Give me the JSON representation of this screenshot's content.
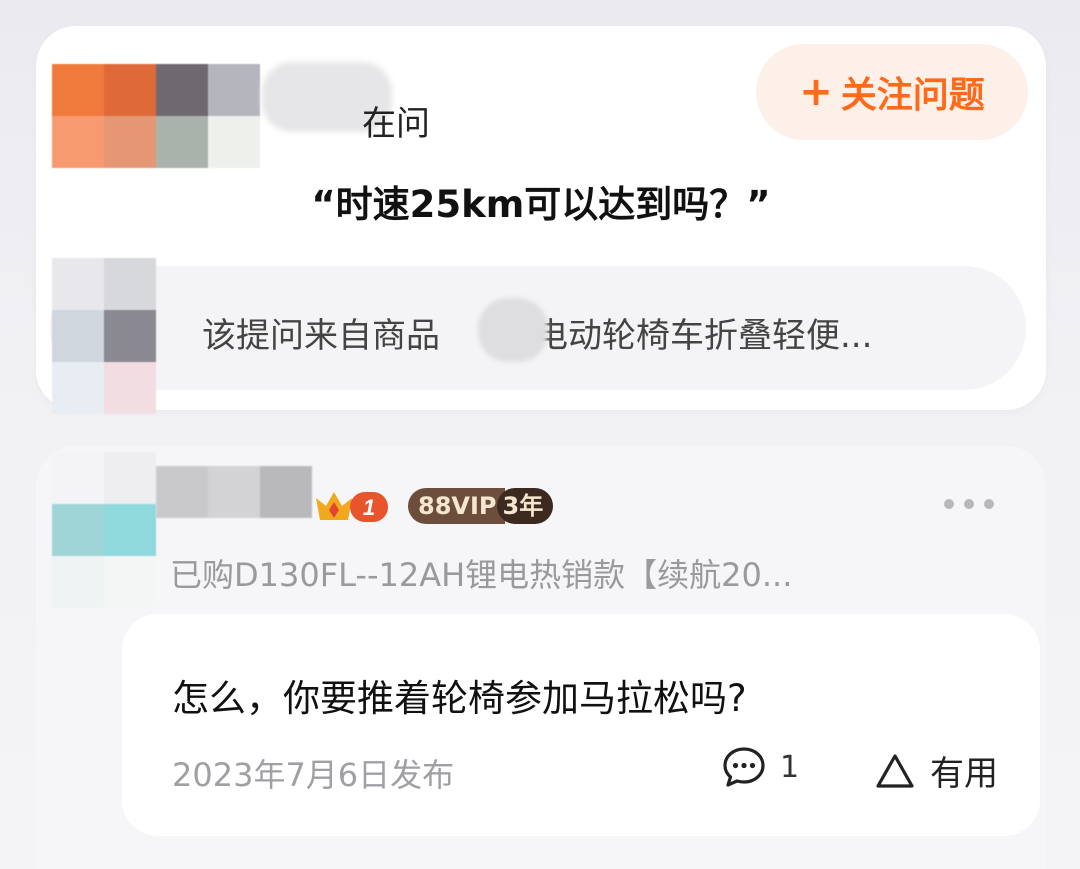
{
  "question": {
    "asking_label": "在问",
    "follow_button": {
      "icon": "plus-icon",
      "label": "关注问题"
    },
    "title": "“时速25km可以达到吗？”",
    "product_source": "该提问来自商品",
    "product_name_visible": "乐电动轮椅车折叠轻便..."
  },
  "answer": {
    "level_badge": "1",
    "vip_badge": {
      "label": "88VIP",
      "years": "3年"
    },
    "more_icon": "more-horizontal-icon",
    "purchase_info": "已购D130FL--12AH锂电热销款【续航20...",
    "text": "怎么，你要推着轮椅参加马拉松吗?",
    "date": "2023年7月6日发布",
    "comment_count": "1",
    "useful_label": "有用"
  },
  "colors": {
    "accent_orange": "#ff6a1a",
    "follow_bg": "#fdf0e8"
  }
}
